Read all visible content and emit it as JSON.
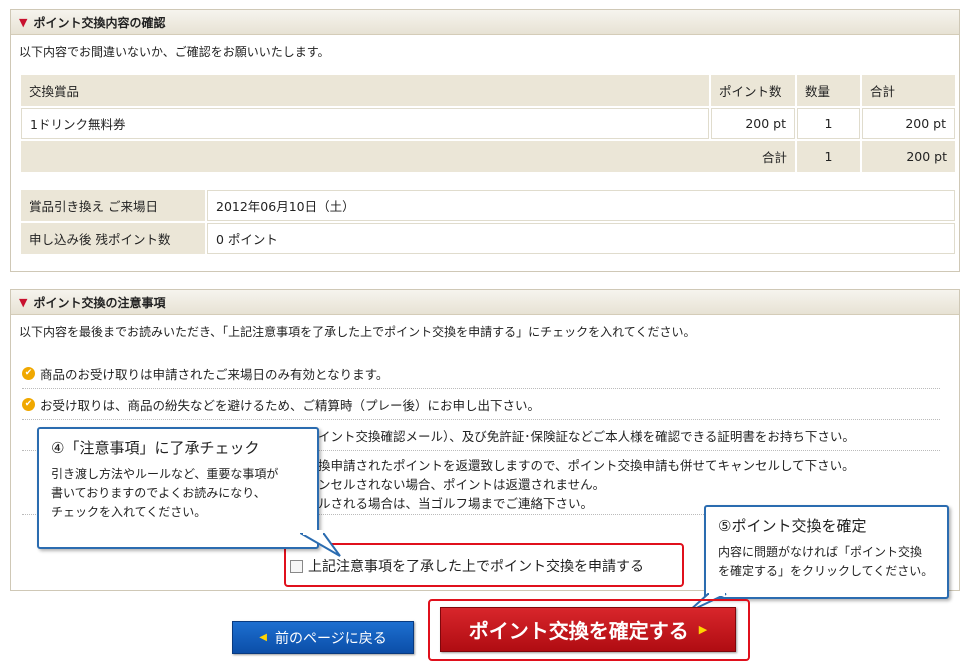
{
  "confirm": {
    "title": "ポイント交換内容の確認",
    "intro": "以下内容でお間違いないか、ご確認をお願いいたします。",
    "headers": [
      "交換賞品",
      "ポイント数",
      "数量",
      "合計"
    ],
    "item": {
      "name": "1ドリンク無料券",
      "points": "200 pt",
      "qty": "1",
      "total": "200 pt"
    },
    "sum": {
      "label": "合計",
      "qty": "1",
      "total": "200 pt"
    },
    "info": [
      {
        "label": "賞品引き換え ご来場日",
        "value": "2012年06月10日（土）"
      },
      {
        "label": "申し込み後 残ポイント数",
        "value": "0 ポイント"
      }
    ]
  },
  "notes": {
    "title": "ポイント交換の注意事項",
    "intro": "以下内容を最後までお読みいただき、「上記注意事項を了承した上でポイント交換を申請する」にチェックを入れてください。",
    "items": [
      "商品のお受け取りは申請されたご来場日のみ有効となります。",
      "お受け取りは、商品の紛失などを避けるため、ご精算時（プレー後）にお申し出下さい。",
      "イント交換確認メール）、及び免許証･保険証などご本人様を確認できる証明書をお持ち下さい。",
      "換申請されたポイントを返還致しますので、ポイント交換申請も併せてキャンセルして下さい。",
      "ンセルされない場合、ポイントは返還されません。",
      "ルされる場合は、当ゴルフ場までご連絡下さい。"
    ],
    "agree_label": "上記注意事項を了承した上でポイント交換を申請する"
  },
  "callout4": {
    "title": "④「注意事項」に了承チェック",
    "lines": [
      "引き渡し方法やルールなど、重要な事項が",
      "書いておりますのでよくお読みになり、",
      "チェックを入れてください。"
    ]
  },
  "callout5": {
    "title": "⑤ポイント交換を確定",
    "lines": [
      "内容に問題がなければ「ポイント交換",
      "を確定する」をクリックしてください。"
    ]
  },
  "buttons": {
    "back": "前のページに戻る",
    "confirm": "ポイント交換を確定する"
  },
  "colors": {
    "accent_red": "#c8102e",
    "callout_blue": "#2b6cb0",
    "header_beige": "#ebe6d7"
  }
}
